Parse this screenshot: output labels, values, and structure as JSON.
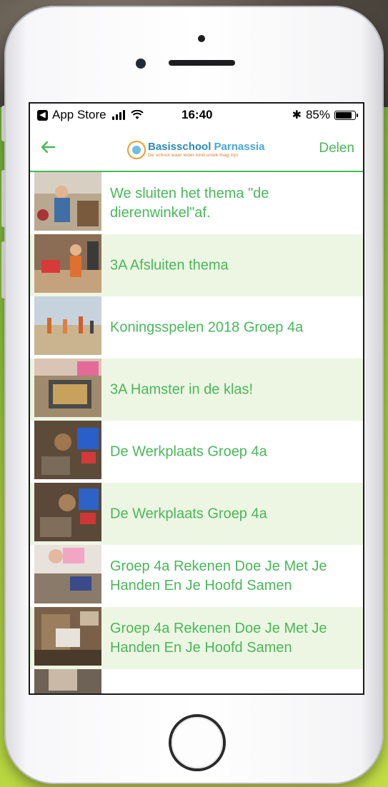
{
  "status_bar": {
    "back_app": "App Store",
    "time": "16:40",
    "battery_percent": "85%",
    "battery_level": 0.85
  },
  "nav": {
    "logo_title_part1": "Basisschool",
    "logo_title_part2": "Parnassia",
    "logo_subtitle": "De school waar ieder kind uniek mag zijn",
    "share_label": "Delen",
    "back_icon": "arrow-left-icon"
  },
  "items": [
    {
      "title": "We sluiten het thema \"de dierenwinkel\"af."
    },
    {
      "title": "3A Afsluiten thema"
    },
    {
      "title": "Koningsspelen 2018 Groep 4a"
    },
    {
      "title": "3A Hamster in de klas!"
    },
    {
      "title": "De Werkplaats Groep 4a"
    },
    {
      "title": "De Werkplaats Groep 4a"
    },
    {
      "title": "Groep 4a Rekenen Doe Je Met Je Handen En Je Hoofd Samen"
    },
    {
      "title": "Groep 4a Rekenen Doe Je Met Je Handen En Je Hoofd Samen"
    },
    {
      "title": ""
    }
  ],
  "colors": {
    "accent": "#4ab75a",
    "row_alt": "#edf6e3"
  }
}
